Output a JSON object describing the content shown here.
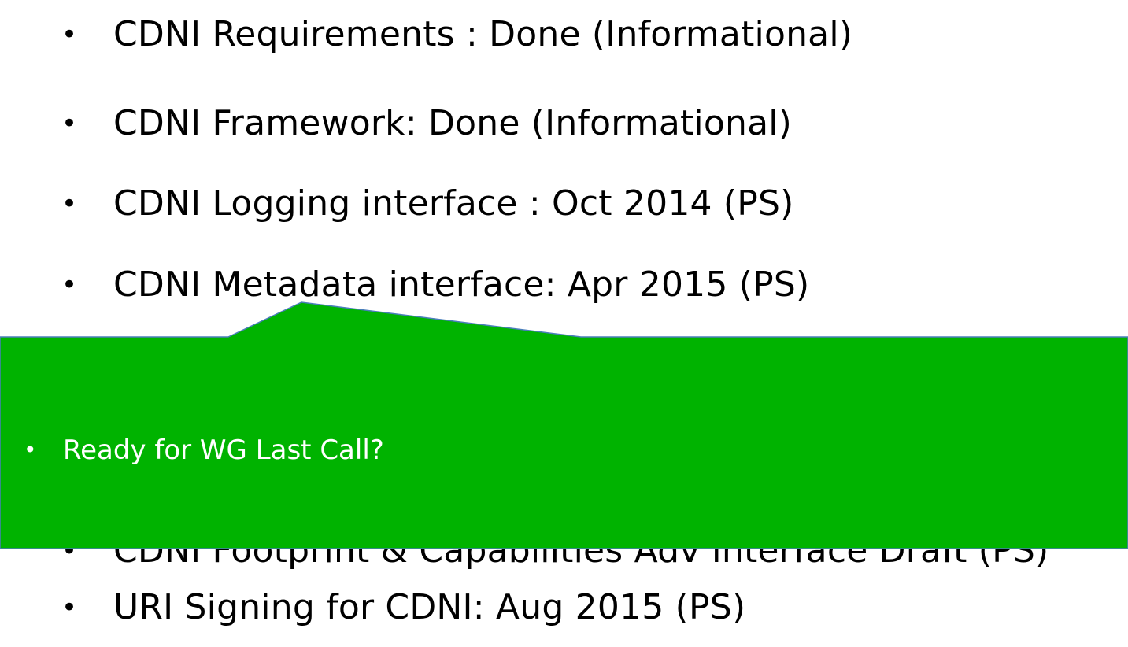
{
  "bullets": [
    {
      "text": "CDNI Requirements : Done (Informational)"
    },
    {
      "text": "CDNI Framework: Done (Informational)"
    },
    {
      "text": "CDNI Logging interface : Oct 2014 (PS)"
    },
    {
      "text": "CDNI Metadata interface: Apr 2015 (PS)"
    },
    {
      "text": "CDNI Footprint & Capabilities Adv Interface Draft (PS)"
    },
    {
      "text": "URI Signing for CDNI: Aug 2015 (PS)"
    }
  ],
  "bullet_symbol": "•",
  "callout": {
    "text": "Ready for WG Last Call?",
    "bullet_symbol": "•",
    "fill_color": "#00b300",
    "border_color": "#4a7ebb",
    "text_color": "#ffffff"
  }
}
